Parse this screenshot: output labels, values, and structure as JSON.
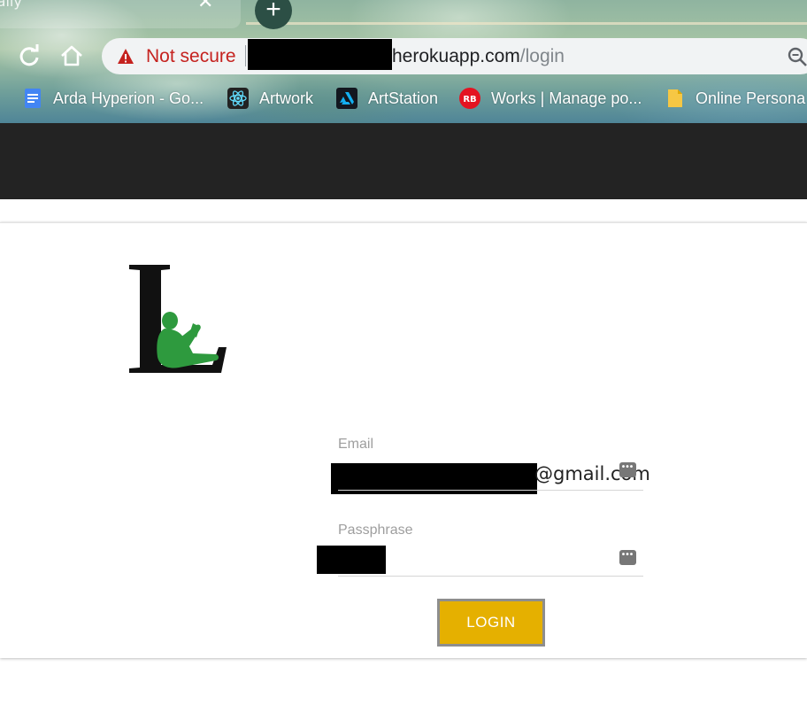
{
  "browser": {
    "tab_title": "l Tally",
    "address": {
      "security_label": "Not secure",
      "host": "herokuapp.com",
      "path": "/login"
    },
    "bookmarks": [
      {
        "label": "Arda Hyperion - Go...",
        "icon": "google-docs-icon"
      },
      {
        "label": "Artwork",
        "icon": "react-atom-icon"
      },
      {
        "label": "ArtStation",
        "icon": "artstation-icon"
      },
      {
        "label": "Works | Manage po...",
        "icon": "redbubble-icon"
      },
      {
        "label": "Online Persona",
        "icon": "folder-icon"
      }
    ],
    "colors": {
      "warning": "#c5221f",
      "toolbar": "#f1f3f4"
    }
  },
  "login": {
    "email_label": "Email",
    "email_value_visible": "@gmail.com",
    "password_label": "Passphrase",
    "button_label": "LOGIN"
  },
  "colors": {
    "navbar": "#232323",
    "button": "#e5b000",
    "logo_figure": "#2e9a3e"
  }
}
